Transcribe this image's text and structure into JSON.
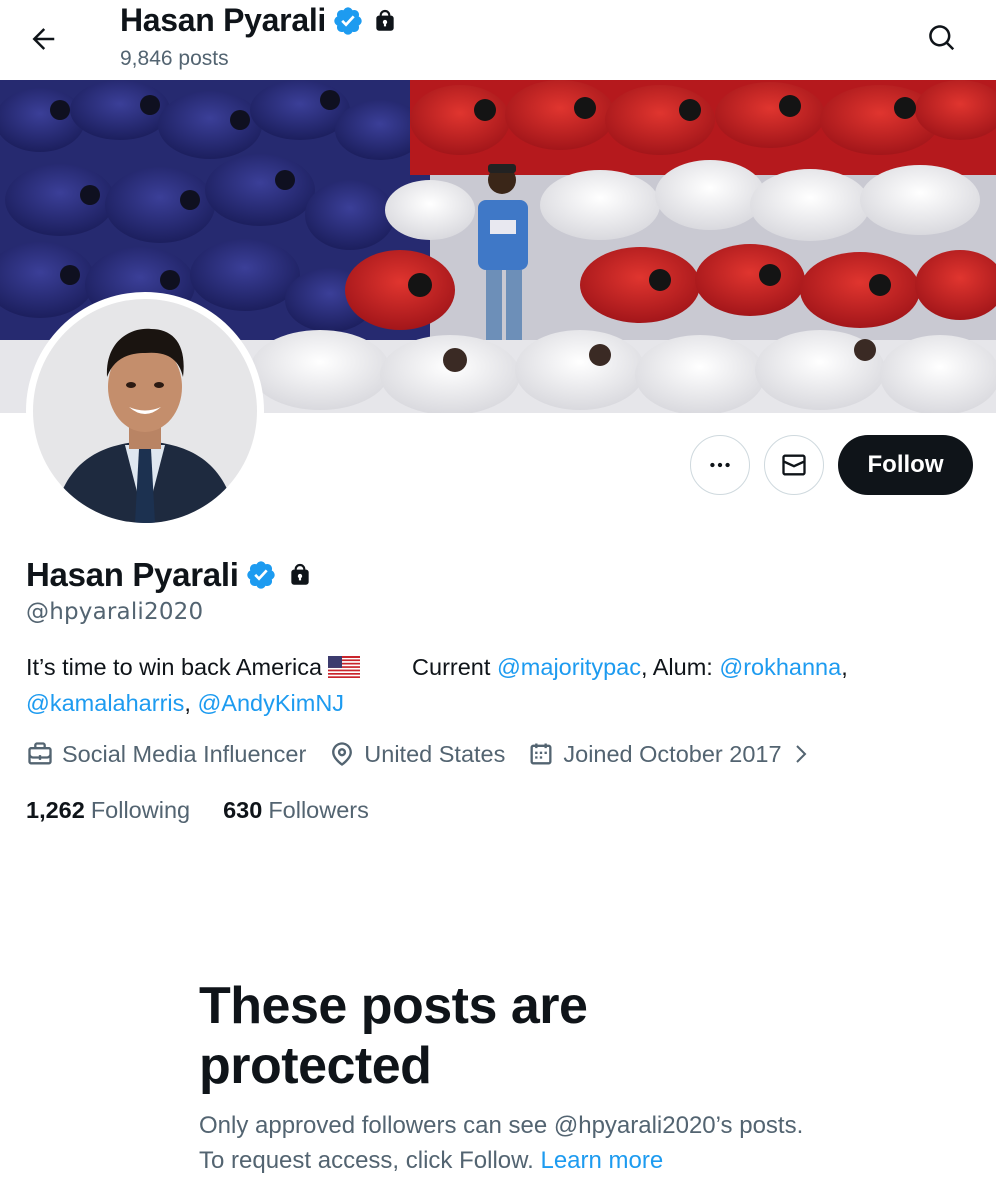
{
  "header": {
    "name": "Hasan Pyarali",
    "posts_count": "9,846 posts"
  },
  "profile": {
    "name": "Hasan Pyarali",
    "handle": "@hpyarali2020",
    "bio": {
      "text1": "It’s time to win back America",
      "flag": "🇺🇸",
      "text2": "Current",
      "mention1": "@majoritypac",
      "text3": ", Alum:",
      "mention2": "@rokhanna",
      "text4": ",",
      "mention3": "@kamalaharris",
      "text5": ",",
      "mention4": "@AndyKimNJ"
    },
    "category": "Social Media Influencer",
    "location": "United States",
    "joined": "Joined October 2017",
    "following_count": "1,262",
    "following_label": "Following",
    "followers_count": "630",
    "followers_label": "Followers"
  },
  "actions": {
    "follow_label": "Follow"
  },
  "protected": {
    "title": "These posts are protected",
    "description": "Only approved followers can see @hpyarali2020’s posts. To request access, click Follow.",
    "learn_more": "Learn more"
  },
  "colors": {
    "accent": "#1d9bf0",
    "text": "#0f1419",
    "secondary": "#536471",
    "verified": "#1d9bf0"
  },
  "icons": [
    "back-arrow-icon",
    "verified-badge-icon",
    "lock-icon",
    "search-icon",
    "more-icon",
    "mail-icon",
    "briefcase-icon",
    "location-pin-icon",
    "calendar-icon",
    "chevron-right-icon"
  ]
}
